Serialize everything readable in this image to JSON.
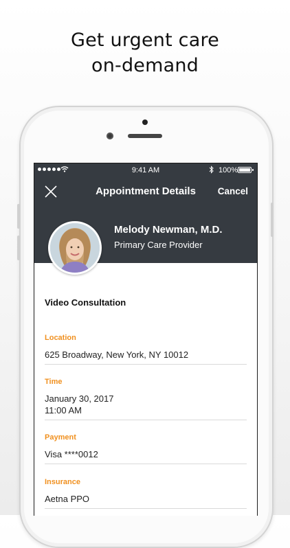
{
  "headline": [
    "Get urgent care",
    "on-demand"
  ],
  "status_bar": {
    "time": "9:41 AM",
    "battery": "100%"
  },
  "nav": {
    "title": "Appointment Details",
    "cancel_label": "Cancel"
  },
  "doctor": {
    "name": "Melody Newman, M.D.",
    "role": "Primary Care Provider"
  },
  "consultation_type": "Video Consultation",
  "details": [
    {
      "label": "Location",
      "value": [
        "625 Broadway, New York, NY 10012"
      ]
    },
    {
      "label": "Time",
      "value": [
        "January 30, 2017",
        "11:00 AM"
      ]
    },
    {
      "label": "Payment",
      "value": [
        "Visa ****0012"
      ]
    },
    {
      "label": "Insurance",
      "value": [
        "Aetna PPO"
      ]
    }
  ],
  "colors": {
    "header_bg": "#363b41",
    "label_accent": "#f0901f"
  }
}
